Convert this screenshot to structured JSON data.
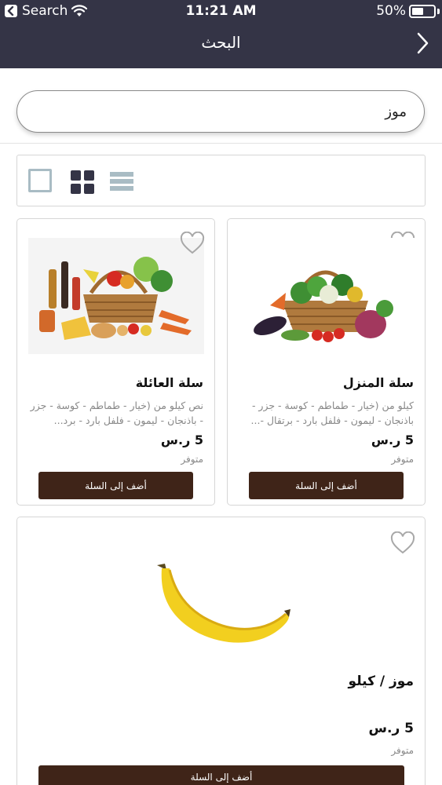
{
  "status_bar": {
    "back_app": "Search",
    "time": "11:21 AM",
    "battery": "50%",
    "battery_level": 0.5
  },
  "header": {
    "title": "البحث",
    "back_icon": "chevron-right-icon"
  },
  "search": {
    "value": "موز",
    "placeholder": ""
  },
  "view_switcher": {
    "options": [
      "single-view-icon",
      "grid-view-icon",
      "list-view-icon"
    ],
    "selected": "grid-view-icon"
  },
  "products": [
    {
      "title": "سلة المنزل",
      "description": "كيلو من (خيار - طماطم - كوسة - جزر - باذنجان - ليمون - فلفل بارد - برتقال -...",
      "price": "5 ر.س",
      "stock": "متوفر",
      "button": "أضف إلى السلة",
      "image": "vegetable-basket-image"
    },
    {
      "title": "سلة العائلة",
      "description": "نص كيلو من (خيار - طماطم - كوسة - جزر - باذنجان - ليمون - فلفل بارد - برد...",
      "price": "5 ر.س",
      "stock": "متوفر",
      "button": "أضف إلى السلة",
      "image": "grocery-basket-image"
    },
    {
      "title": "موز / كيلو",
      "description": "",
      "price": "5 ر.س",
      "stock": "متوفر",
      "button": "أضف إلى السلة",
      "image": "banana-image"
    }
  ],
  "colors": {
    "header_bg": "#343446",
    "button_bg": "#3f2418",
    "accent_light": "#a9bcc4"
  }
}
